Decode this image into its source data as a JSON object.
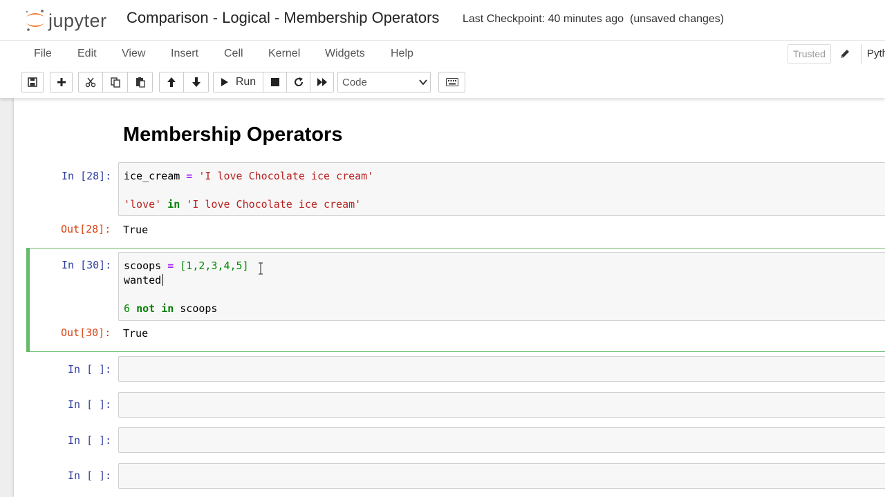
{
  "header": {
    "logo_text": "jupyter",
    "notebook_title": "Comparison - Logical - Membership Operators",
    "checkpoint": "Last Checkpoint: 40 minutes ago",
    "unsaved": "(unsaved changes)"
  },
  "menubar": {
    "items": [
      {
        "label": "File"
      },
      {
        "label": "Edit"
      },
      {
        "label": "View"
      },
      {
        "label": "Insert"
      },
      {
        "label": "Cell"
      },
      {
        "label": "Kernel"
      },
      {
        "label": "Widgets"
      },
      {
        "label": "Help"
      }
    ],
    "trusted": "Trusted",
    "kernel": "Pyth"
  },
  "toolbar": {
    "run_label": "Run",
    "cell_type": "Code",
    "icons": [
      "save-icon",
      "plus-icon",
      "cut-icon",
      "copy-icon",
      "paste-icon",
      "arrow-up-icon",
      "arrow-down-icon",
      "run-icon",
      "stop-icon",
      "restart-icon",
      "fast-forward-icon",
      "chevron-down-icon",
      "keyboard-icon"
    ]
  },
  "notebook": {
    "heading": "Membership Operators",
    "cells": [
      {
        "in_prompt": "In [28]:",
        "code": {
          "c1_var": "ice_cream",
          "c1_eq": " = ",
          "c1_str": "'I love Chocolate ice cream'",
          "c2_str1": "'love'",
          "c2_in": "in",
          "c2_str2": "'I love Chocolate ice cream'"
        },
        "out_prompt": "Out[28]:",
        "output": "True"
      },
      {
        "in_prompt": "In [30]:",
        "code": {
          "l1_var": "scoops",
          "l1_eq": " = ",
          "l1_list": "[1,2,3,4,5]",
          "l2": "wanted",
          "l3_num": "6",
          "l3_not": "not",
          "l3_in": "in",
          "l3_var": "scoops"
        },
        "out_prompt": "Out[30]:",
        "output": "True"
      },
      {
        "in_prompt": "In [ ]:"
      },
      {
        "in_prompt": "In [ ]:"
      },
      {
        "in_prompt": "In [ ]:"
      },
      {
        "in_prompt": "In [ ]:"
      }
    ]
  },
  "colors": {
    "selected_border": "#66bb6a",
    "in_prompt": "#303f9f",
    "out_prompt": "#d84315",
    "string": "#ba2121",
    "keyword": "#008000",
    "logo_orange": "#f37626"
  }
}
